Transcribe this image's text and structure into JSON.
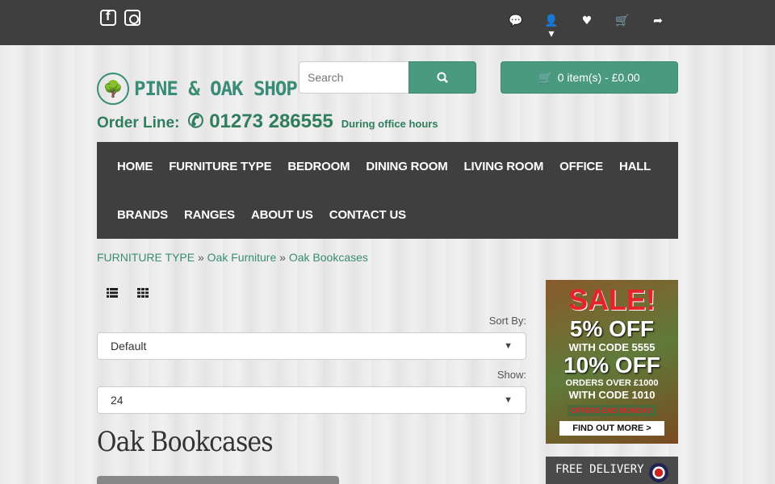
{
  "topbar": {
    "social": [
      "facebook-icon",
      "instagram-icon"
    ],
    "icons": [
      {
        "name": "comments-icon",
        "glyph": "💬"
      },
      {
        "name": "user-icon",
        "glyph": "👤▾"
      },
      {
        "name": "heart-icon",
        "glyph": "♥"
      },
      {
        "name": "cart-icon",
        "glyph": "🛒"
      },
      {
        "name": "share-icon",
        "glyph": "➦"
      }
    ]
  },
  "header": {
    "logo_text": "PINE & OAK SHOP",
    "search_placeholder": "Search",
    "cart_label": "0 item(s) - £0.00",
    "order_label": "Order Line:",
    "phone": "01273 286555",
    "hours": "During office hours"
  },
  "nav": {
    "row1": [
      "HOME",
      "FURNITURE TYPE",
      "BEDROOM",
      "DINING ROOM",
      "LIVING ROOM",
      "OFFICE",
      "HALL"
    ],
    "row2": [
      "BRANDS",
      "RANGES",
      "ABOUT US",
      "CONTACT US"
    ]
  },
  "breadcrumb": {
    "items": [
      "FURNITURE TYPE",
      "Oak Furniture",
      "Oak Bookcases"
    ],
    "sep": "»"
  },
  "controls": {
    "sort_label": "Sort By:",
    "sort_value": "Default",
    "show_label": "Show:",
    "show_value": "24"
  },
  "page": {
    "title": "Oak Bookcases"
  },
  "sale": {
    "title": "SALE!",
    "line1": "5% OFF",
    "line1_sub": "WITH CODE",
    "line1_code": "5555",
    "line2": "10% OFF",
    "line2_sub": "ORDERS OVER £1000",
    "line2_code": "WITH CODE 1010",
    "ends": "OFFERS END MONDAY!",
    "cta": "FIND OUT MORE >"
  },
  "delivery": {
    "label": "FREE DELIVERY"
  },
  "colors": {
    "accent": "#4a9a7f",
    "dark": "#3f3f3f",
    "sale_red": "#e4232b"
  }
}
